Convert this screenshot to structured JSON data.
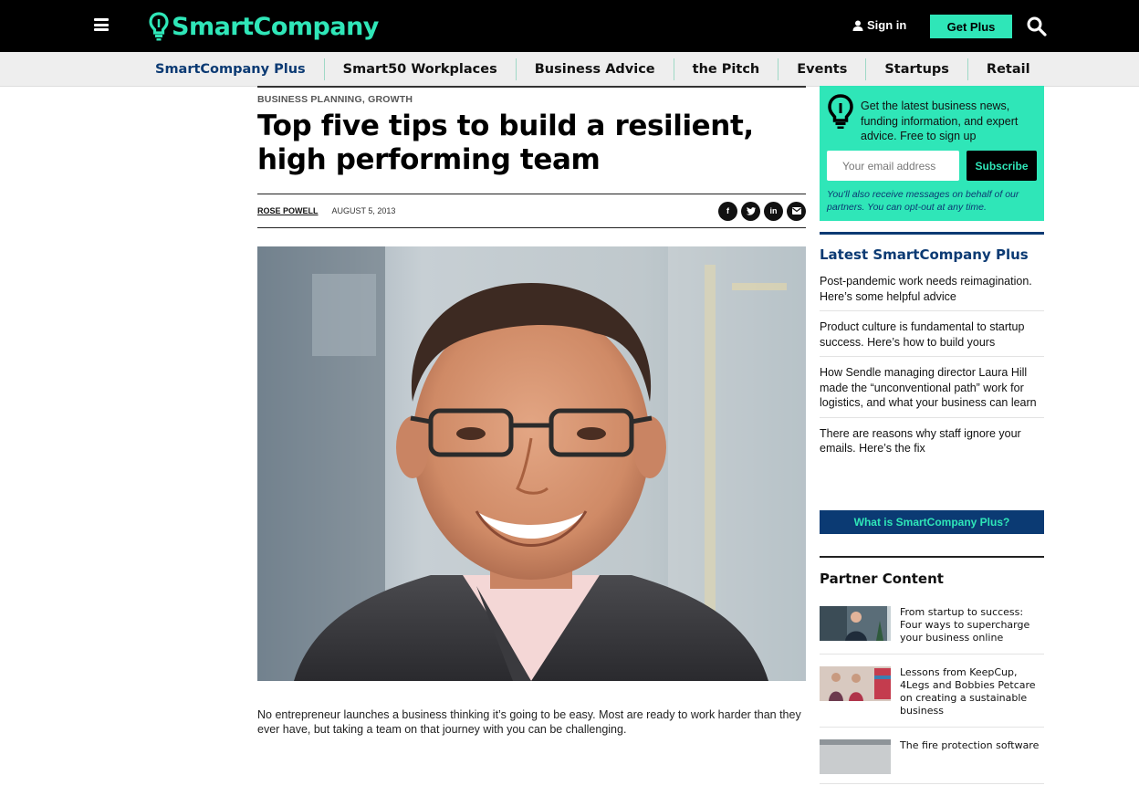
{
  "header": {
    "logo_text": "SmartCompany",
    "sign_in": "Sign in",
    "get_plus": "Get Plus",
    "brand_color": "#2fe6b8"
  },
  "nav": {
    "items": [
      {
        "label": "SmartCompany Plus"
      },
      {
        "label": "Smart50 Workplaces"
      },
      {
        "label": "Business Advice"
      },
      {
        "label": "the Pitch"
      },
      {
        "label": "Events"
      },
      {
        "label": "Startups"
      },
      {
        "label": "Retail"
      }
    ]
  },
  "article": {
    "category_1": "BUSINESS PLANNING",
    "category_sep": ",",
    "category_2": "GROWTH",
    "title": "Top five tips to build a resilient, high performing team",
    "author": "ROSE POWELL",
    "date": "AUGUST 5, 2013",
    "share_icons": [
      "facebook-icon",
      "twitter-icon",
      "linkedin-icon",
      "email-icon"
    ],
    "lede": "No entrepreneur launches a business thinking it’s going to be easy. Most are ready to work harder than they ever have, but taking a team on that journey with you can be challenging."
  },
  "sidebar": {
    "signup_text": "Get the latest business news, funding information, and expert advice. Free to sign up",
    "email_placeholder": "Your email address",
    "subscribe": "Subscribe",
    "optout": "You'll also receive messages on behalf of our partners. You can opt-out at any time.",
    "plus_heading": "Latest SmartCompany Plus",
    "plus_items": [
      {
        "title": "Post-pandemic work needs reimagination. Here’s some helpful advice"
      },
      {
        "title": "Product culture is fundamental to startup success. Here’s how to build yours"
      },
      {
        "title": "How Sendle managing director Laura Hill made the “unconventional path” work for logistics, and what your business can learn"
      },
      {
        "title": "There are reasons why staff ignore your emails. Here’s the fix"
      }
    ],
    "what_is_plus": "What is SmartCompany Plus?",
    "partner_heading": "Partner Content",
    "partner_items": [
      {
        "title": "From startup to success: Four ways to supercharge your business online"
      },
      {
        "title": "Lessons from KeepCup, 4Legs and Bobbies Petcare on creating a sustainable business"
      },
      {
        "title": "The fire protection software"
      }
    ]
  }
}
